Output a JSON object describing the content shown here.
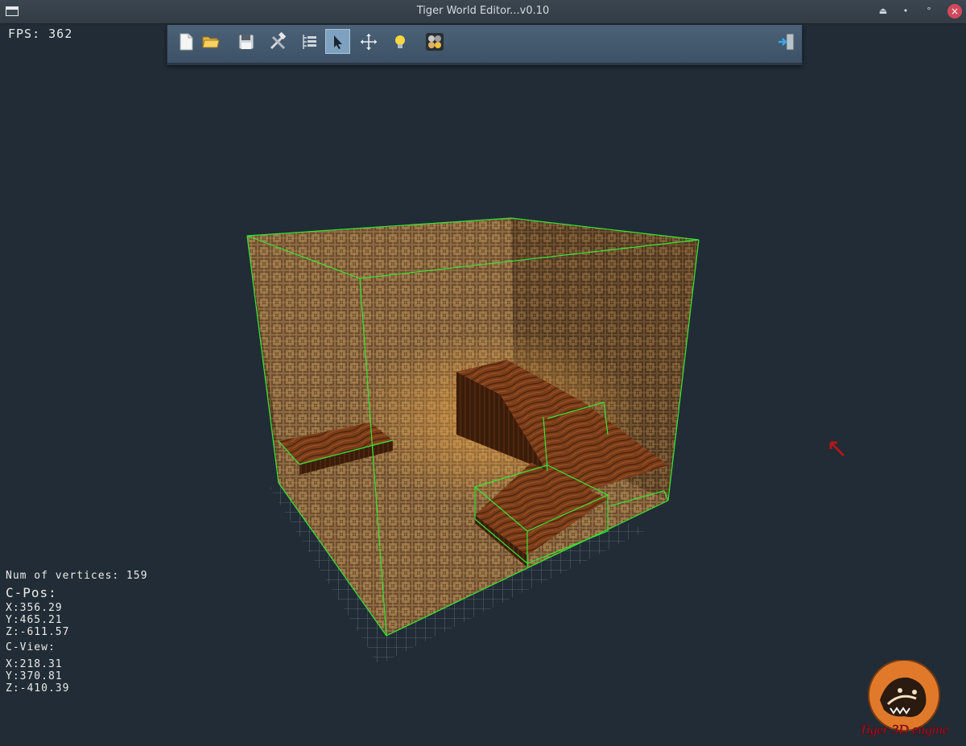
{
  "window": {
    "title": "Tiger World Editor...v0.10"
  },
  "hud": {
    "fps": "FPS: 362",
    "vertices": "Num of vertices: 159",
    "cpos_label": "C-Pos:",
    "cpos_x": "X:356.29",
    "cpos_y": "Y:465.21",
    "cpos_z": "Z:-611.57",
    "cview_label": "C-View:",
    "cview_x": "X:218.31",
    "cview_y": "Y:370.81",
    "cview_z": "Z:-410.39"
  },
  "toolbar": {
    "buttons": [
      {
        "name": "new-file",
        "icon": "new-file-icon",
        "active": false
      },
      {
        "name": "open-folder",
        "icon": "folder-icon",
        "active": false
      },
      {
        "name": "save",
        "icon": "floppy-icon",
        "active": false
      },
      {
        "name": "tools",
        "icon": "hammer-wrench-icon",
        "active": false
      },
      {
        "name": "scene-tree",
        "icon": "tree-list-icon",
        "active": false
      },
      {
        "name": "select",
        "icon": "cursor-arrow-icon",
        "active": true
      },
      {
        "name": "move",
        "icon": "move-arrows-icon",
        "active": false
      },
      {
        "name": "light",
        "icon": "lightbulb-icon",
        "active": false
      },
      {
        "name": "materials",
        "icon": "material-balls-icon",
        "active": false
      },
      {
        "name": "exit",
        "icon": "exit-door-icon",
        "active": false
      }
    ]
  },
  "logo": {
    "text": "Tiger 3D engine"
  },
  "colors": {
    "background": "#212c36",
    "wireframe": "#34e634",
    "wall": "#8a6038",
    "wood": "#7a3d1a",
    "logo_text": "#c8102e",
    "logo_circle": "#e07a2a"
  }
}
